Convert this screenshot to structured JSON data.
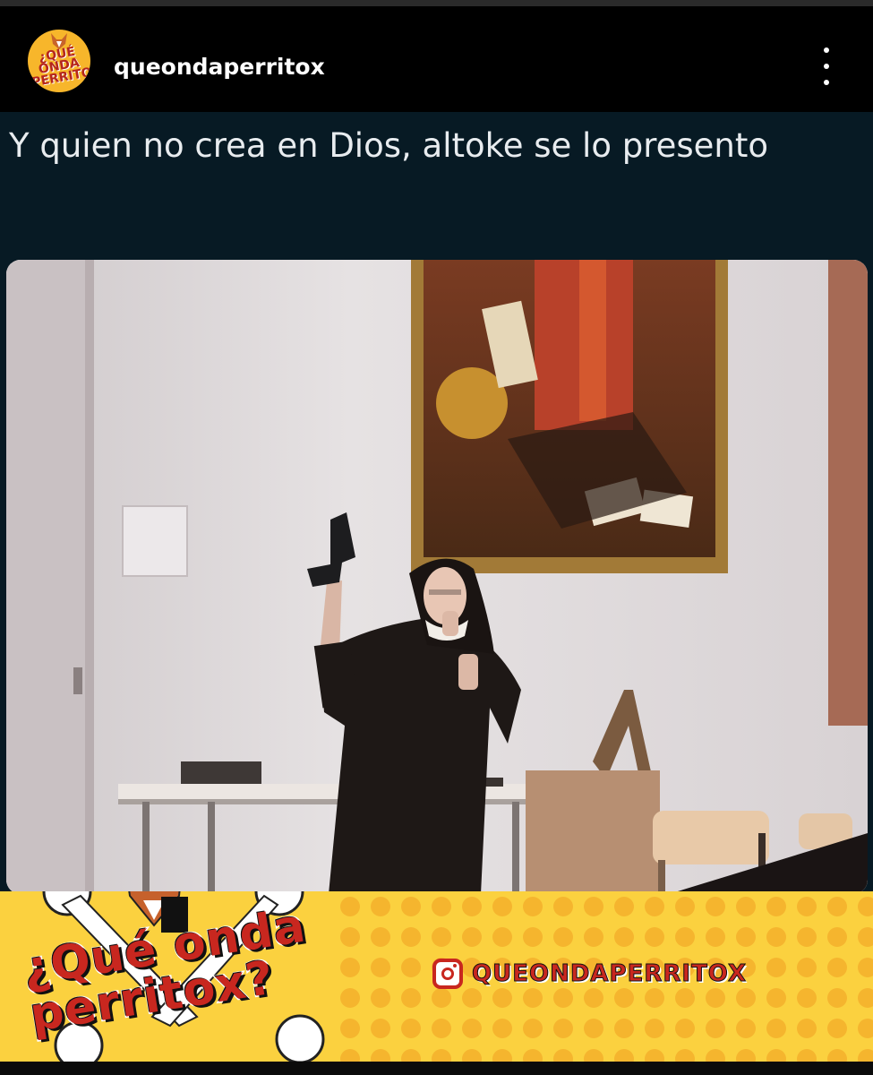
{
  "header": {
    "username": "queondaperritox",
    "avatar_label": "¿Qué onda perritox?"
  },
  "post": {
    "caption": "Y quien no crea en Dios, altoke se lo presento",
    "photo_description": "Photo of a nun in a classroom holding up a handgun"
  },
  "banner": {
    "logo_line1": "¿Qué onda",
    "logo_line2": "perritox?",
    "instagram_handle": "QUEONDAPERRITOX"
  },
  "icons": {
    "more": "more-vertical-icon",
    "instagram": "instagram-icon"
  },
  "colors": {
    "background": "#000000",
    "post_background": "#071a24",
    "banner_yellow": "#f9c739",
    "brand_red": "#c8271f",
    "caption_text": "#e8ecef"
  }
}
